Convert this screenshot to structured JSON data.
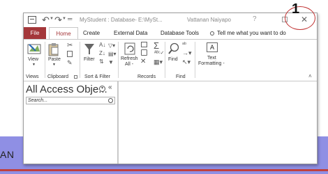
{
  "background_band": {
    "text": "AN",
    "color": "#8f8fe4",
    "line_color": "#c04040"
  },
  "titlebar": {
    "title": "MyStudent : Database- E:\\MySt...",
    "user": "Vattanan Naiyapo",
    "help": "?",
    "close": "✕"
  },
  "tabs": {
    "file": "File",
    "home": "Home",
    "create": "Create",
    "external": "External Data",
    "dbtools": "Database Tools",
    "tell": "Tell me what you want to do"
  },
  "ribbon": {
    "views": {
      "view_label": "View",
      "group": "Views"
    },
    "clipboard": {
      "paste_label": "Paste",
      "group": "Clipboard"
    },
    "sortfilter": {
      "filter_label": "Filter",
      "group": "Sort & Filter"
    },
    "records": {
      "refresh_label": "Refresh",
      "refresh_sub": "All -",
      "group": "Records"
    },
    "find": {
      "find_label": "Find",
      "group": "Find"
    },
    "text": {
      "label": "Text",
      "label2": "Formatting -",
      "icon_letter": "A"
    }
  },
  "nav": {
    "title": "All Access Obje...",
    "collapse": "«",
    "search_placeholder": "Search..."
  },
  "annotation": {
    "number": "1",
    "color": "#c03030"
  },
  "colors": {
    "accent": "#a4373a"
  }
}
